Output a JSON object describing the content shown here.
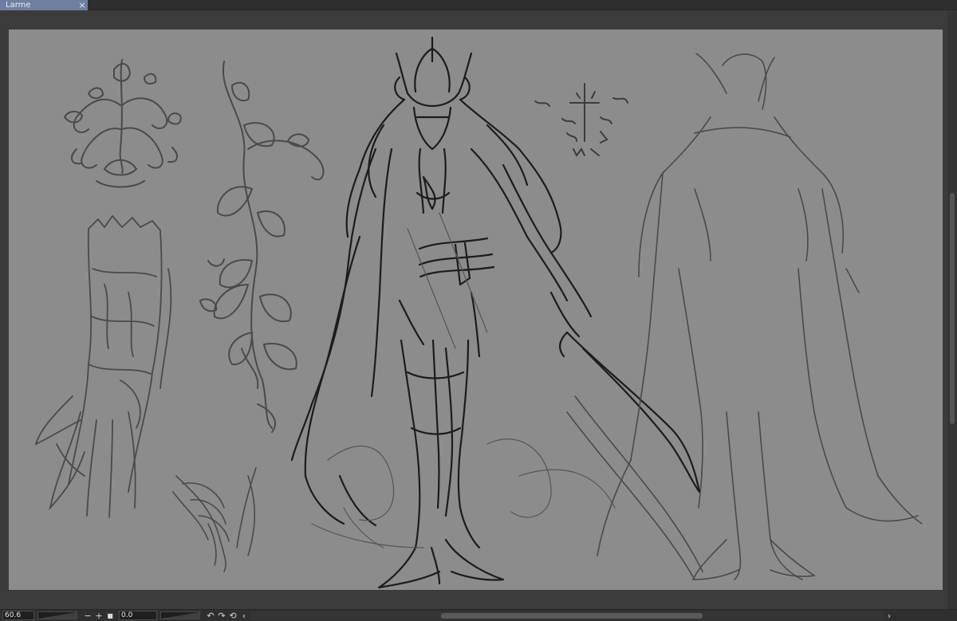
{
  "document_tab": {
    "title": "Larme",
    "close_glyph": "×"
  },
  "status": {
    "zoom_value": "60.6",
    "zoom_out_glyph": "−",
    "zoom_in_glyph": "+",
    "fit_glyph": "■",
    "rotation_value": "0.0",
    "rotate_left_glyph": "↶",
    "rotate_right_glyph": "↷",
    "reset_glyph": "⟲",
    "scroll_left_glyph": "‹",
    "scroll_right_glyph": "›"
  },
  "colors": {
    "canvas": "#8c8c8c",
    "ink": "#1c1c1c",
    "sketch": "#4a4a4a",
    "tab_active": "#6f7fa0"
  },
  "icons": [
    "close-icon",
    "zoom-out-icon",
    "zoom-in-icon",
    "fit-screen-icon",
    "rotate-left-icon",
    "rotate-right-icon",
    "reset-rotation-icon",
    "scroll-left-icon",
    "scroll-right-icon"
  ]
}
